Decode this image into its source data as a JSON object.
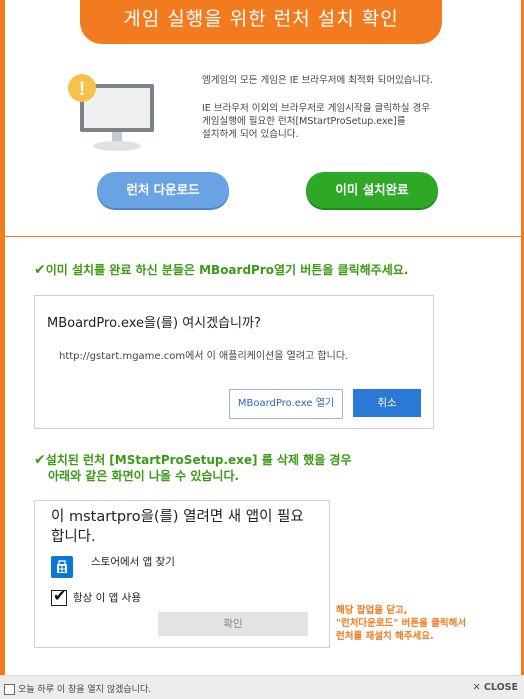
{
  "header": {
    "title": "게임 실행을 위한 런처 설치 확인"
  },
  "intro": {
    "line1": "엠게임의 모든 게임은 IE 브라우저에 최적화 되어있습니다.",
    "line2": "IE 브라우저 이외의 브라우저로 게임시작을 클릭하실 경우",
    "line3": "게임실행에 필요한 런처[MStartProSetup.exe]를",
    "line4": "설치하게 되어 있습니다.",
    "warning_symbol": "!"
  },
  "buttons": {
    "download": "런처 다운로드",
    "installed": "이미 설치완료"
  },
  "section1": {
    "check": "✔",
    "message": "이미 설치를 완료 하신 분들은 MBoardPro열기 버튼을 클릭해주세요.",
    "dialog": {
      "title": "MBoardPro.exe을(를) 여시겠습니까?",
      "text": "http://gstart.mgame.com에서 이 애플리케이션을 열려고 합니다.",
      "open_button": "MBoardPro.exe 열기",
      "cancel_button": "취소"
    }
  },
  "section2": {
    "check": "✔",
    "line1": "설치된 런처 [MStartProSetup.exe] 를 삭제 했을 경우",
    "line2": "아래와 같은 화면이 나올 수 있습니다.",
    "dialog": {
      "title": "이 mstartpro을(를) 열려면 새 앱이 필요합니다.",
      "store_link": "스토어에서 앱 찾기",
      "checkbox_mark": "✔",
      "always_use": "항상 이 앱 사용",
      "ok_button": "확인"
    },
    "note_line1": "해당 팝업을 닫고,",
    "note_line2": "\"런처다운로드\" 버튼을 클릭해서",
    "note_line3": "런처를 재설치 해주세요."
  },
  "footer": {
    "dont_show": "오늘 하루 이 창을 열지 않겠습니다.",
    "close": "✕ CLOSE"
  },
  "colors": {
    "accent": "#f27b1f",
    "green": "#2ea827",
    "blue": "#6aa3e3",
    "text_green": "#3b9a16"
  }
}
